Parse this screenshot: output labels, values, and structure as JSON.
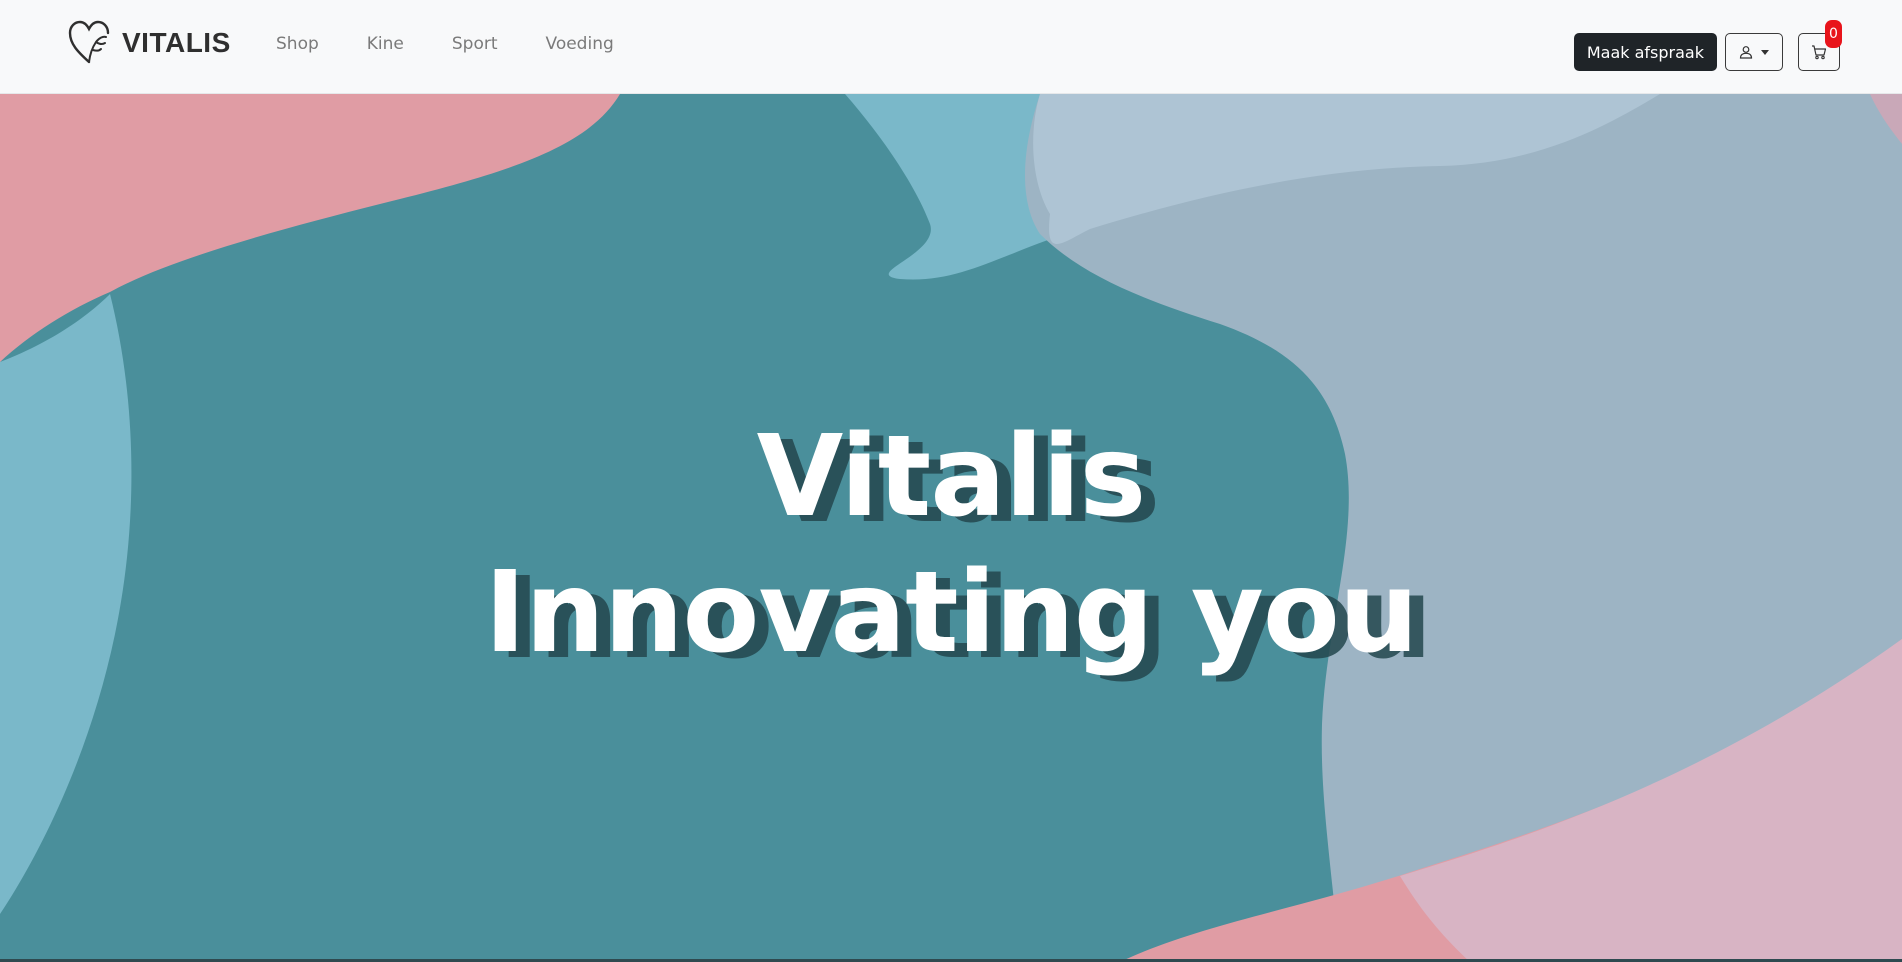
{
  "brand": {
    "name": "VITALIS"
  },
  "nav": {
    "links": [
      {
        "label": "Shop"
      },
      {
        "label": "Kine"
      },
      {
        "label": "Sport"
      },
      {
        "label": "Voeding"
      }
    ]
  },
  "actions": {
    "appointment_label": "Maak afspraak",
    "cart_count": "0"
  },
  "hero": {
    "line1": "Vitalis",
    "line2": "Innovating you"
  },
  "colors": {
    "teal": "#4a8f9b",
    "pink": "#e09ca4",
    "light_blue": "#7ab8c9",
    "grey_blue": "#a7bdcd",
    "badge_red": "#e8141b",
    "dark_button": "#1f2428"
  },
  "icons": [
    "logo-heart-icon",
    "user-icon",
    "chevron-down-icon",
    "cart-icon"
  ]
}
